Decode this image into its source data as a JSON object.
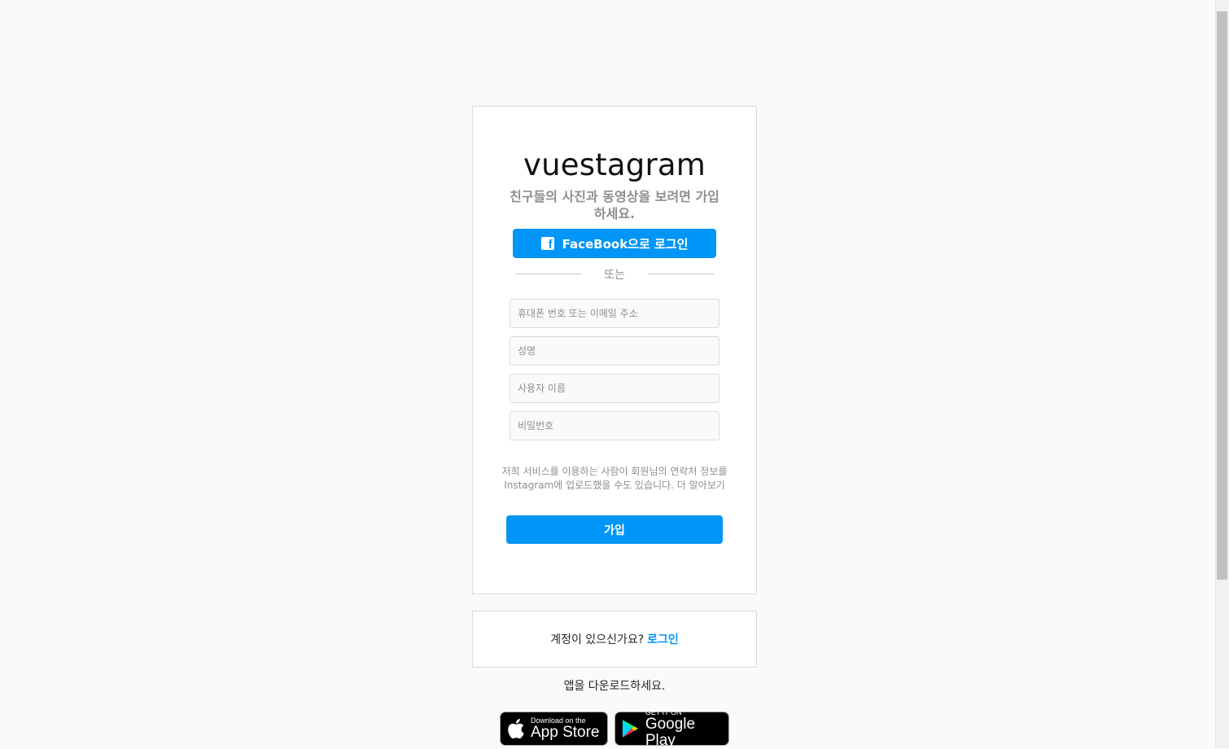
{
  "signup": {
    "logo": "vuestagram",
    "tagline": "친구들의 사진과 동영상을 보려면 가입하세요.",
    "facebook_button": "FaceBook으로 로그인",
    "divider": "또는",
    "fields": {
      "contact_placeholder": "휴대폰 번호 또는 이메일 주소",
      "fullname_placeholder": "성명",
      "username_placeholder": "사용자 이름",
      "password_placeholder": "비밀번호"
    },
    "disclaimer": "저희 서비스를 이용하는 사람이 회원님의 연락처 정보를 Instagram에 업로드했을 수도 있습니다. 더 알아보기",
    "signup_button": "가입"
  },
  "login_prompt": {
    "text": "계정이 있으신가요?",
    "link": "로그인"
  },
  "get_app": {
    "text": "앱을 다운로드하세요.",
    "app_store": {
      "small": "Download on the",
      "large": "App Store"
    },
    "google_play": {
      "small": "GET IT ON",
      "large": "Google Play"
    }
  },
  "colors": {
    "accent": "#0095f6",
    "background": "#fafafa",
    "border": "#dbdbdb",
    "muted_text": "#8e8e8e"
  }
}
